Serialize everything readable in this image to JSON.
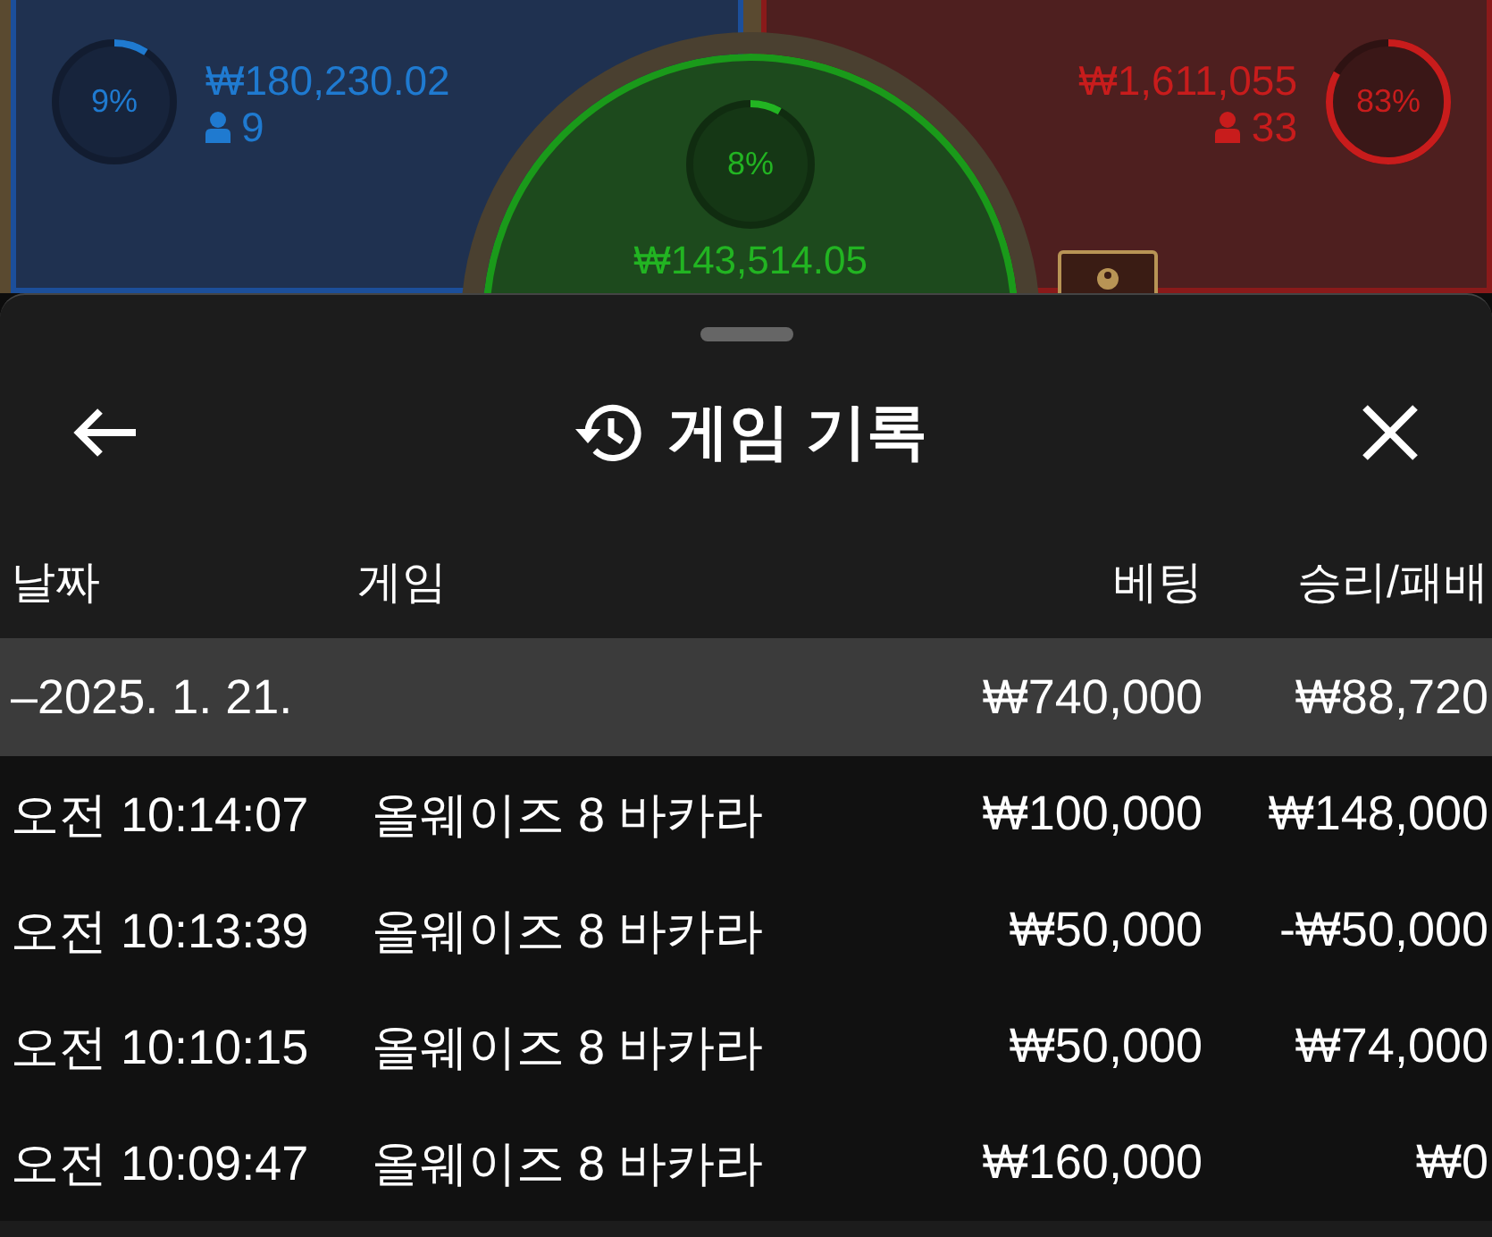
{
  "bet_spots": [
    {
      "kind": "player",
      "percent": "9%",
      "level": 0.09,
      "amount": "₩180,230.02",
      "players": "9"
    },
    {
      "kind": "tie",
      "percent": "8%",
      "level": 0.08,
      "amount": "₩143,514.05"
    },
    {
      "kind": "banker",
      "percent": "83%",
      "level": 0.83,
      "amount": "₩1,611,055",
      "players": "33"
    }
  ],
  "sheet": {
    "title": "게임 기록",
    "columns": [
      "날짜",
      "게임",
      "베팅",
      "승리/패배"
    ],
    "date_group": {
      "date": "–2025. 1. 21.",
      "bet": "₩740,000",
      "result": "₩88,720"
    },
    "rows": [
      {
        "time": "오전 10:14:07",
        "game": "올웨이즈 8 바카라",
        "bet": "₩100,000",
        "result": "₩148,000"
      },
      {
        "time": "오전 10:13:39",
        "game": "올웨이즈 8 바카라",
        "bet": "₩50,000",
        "result": "-₩50,000"
      },
      {
        "time": "오전 10:10:15",
        "game": "올웨이즈 8 바카라",
        "bet": "₩50,000",
        "result": "₩74,000"
      },
      {
        "time": "오전 10:09:47",
        "game": "올웨이즈 8 바카라",
        "bet": "₩160,000",
        "result": "₩0"
      }
    ]
  }
}
